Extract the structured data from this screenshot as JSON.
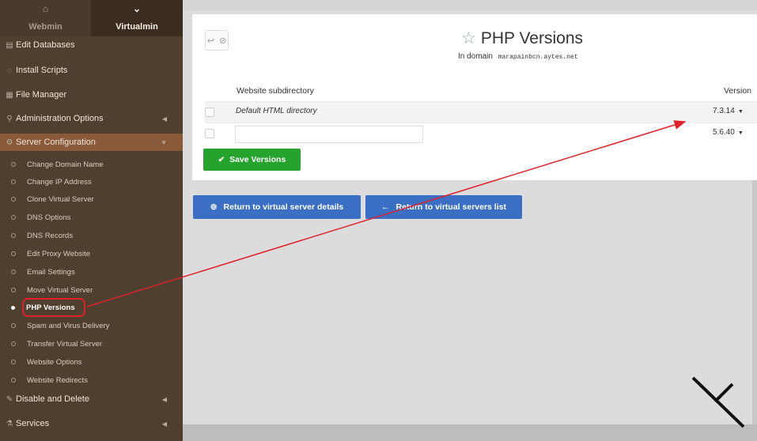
{
  "sidebar": {
    "tabs": {
      "webmin": "Webmin",
      "virtualmin": "Virtualmin"
    },
    "top_items": [
      {
        "label": "Edit Databases",
        "icon": "database-icon"
      },
      {
        "label": "Install Scripts",
        "icon": "scripts-icon"
      },
      {
        "label": "File Manager",
        "icon": "folder-icon"
      },
      {
        "label": "Administration Options",
        "icon": "key-icon"
      },
      {
        "label": "Server Configuration",
        "icon": "cogs-icon"
      }
    ],
    "sub_items": [
      "Change Domain Name",
      "Change IP Address",
      "Clone Virtual Server",
      "DNS Options",
      "DNS Records",
      "Edit Proxy Website",
      "Email Settings",
      "Move Virtual Server",
      "PHP Versions",
      "Spam and Virus Delivery",
      "Transfer Virtual Server",
      "Website Options",
      "Website Redirects"
    ],
    "bottom_items": [
      {
        "label": "Disable and Delete",
        "icon": "wrench-icon"
      },
      {
        "label": "Services",
        "icon": "services-icon"
      }
    ],
    "active_item": "PHP Versions"
  },
  "page": {
    "title": "PHP Versions",
    "subtitle_prefix": "In domain",
    "domain": "marapainbcn.aytes.net"
  },
  "table": {
    "headers": {
      "directory": "Website subdirectory",
      "version": "Version"
    },
    "rows": [
      {
        "directory": "Default HTML directory",
        "version": "7.3.14"
      },
      {
        "directory": "",
        "version": "5.6.40"
      }
    ]
  },
  "buttons": {
    "save": "Save Versions",
    "return_details": "Return to virtual server details",
    "return_list": "Return to virtual servers list"
  },
  "colors": {
    "sidebar_bg": "#4f3f2f",
    "save_green": "#25a32c",
    "button_blue": "#3a6fc4",
    "annotation_red": "#e0202a"
  }
}
